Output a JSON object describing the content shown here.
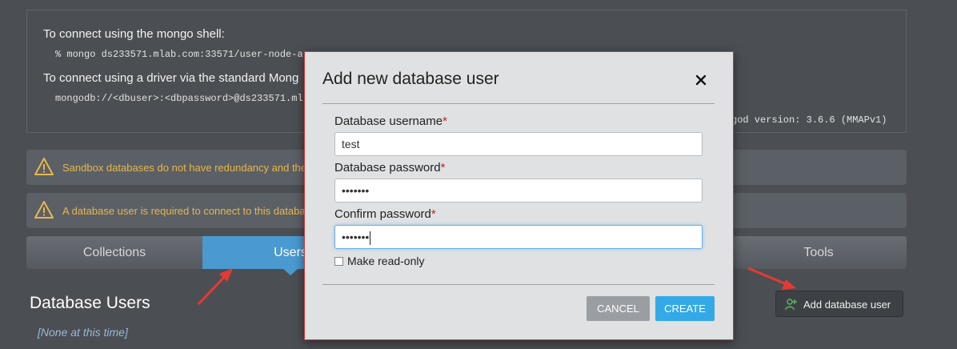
{
  "connection": {
    "shell_heading": "To connect using the mongo shell:",
    "shell_command": "% mongo ds233571.mlab.com:33571/user-node-a",
    "driver_heading": "To connect using a driver via the standard Mong",
    "driver_uri": "mongodb://<dbuser>:<dbpassword>@ds233571.ml",
    "version_text": "god version: 3.6.6 (MMAPv1)"
  },
  "alerts": [
    {
      "text": "Sandbox databases do not have redundancy and ther",
      "icon": "warning-icon"
    },
    {
      "text": "A database user is required to connect to this databa",
      "icon": "warning-icon"
    }
  ],
  "tabs": [
    {
      "label": "Collections"
    },
    {
      "label": "Users"
    },
    {
      "label": "Tools"
    }
  ],
  "users_section": {
    "title": "Database Users",
    "empty_text": "[None at this time]",
    "add_button_label": "Add database user",
    "add_button_icon": "add-user-icon"
  },
  "modal": {
    "title": "Add new database user",
    "close_icon": "close-icon",
    "username_label": "Database username",
    "username_value": "test",
    "password_label": "Database password",
    "password_value": "•••••••",
    "confirm_label": "Confirm password",
    "confirm_value": "•••••••",
    "required_marker": "*",
    "readonly_label": "Make read-only",
    "readonly_checked": false,
    "cancel_label": "CANCEL",
    "create_label": "CREATE"
  },
  "colors": {
    "background": "#4b4f54",
    "accent": "#4a9ad0",
    "create_button": "#33a9e8",
    "warning_text": "#e8b64c",
    "annotation_arrow": "#e53935"
  }
}
